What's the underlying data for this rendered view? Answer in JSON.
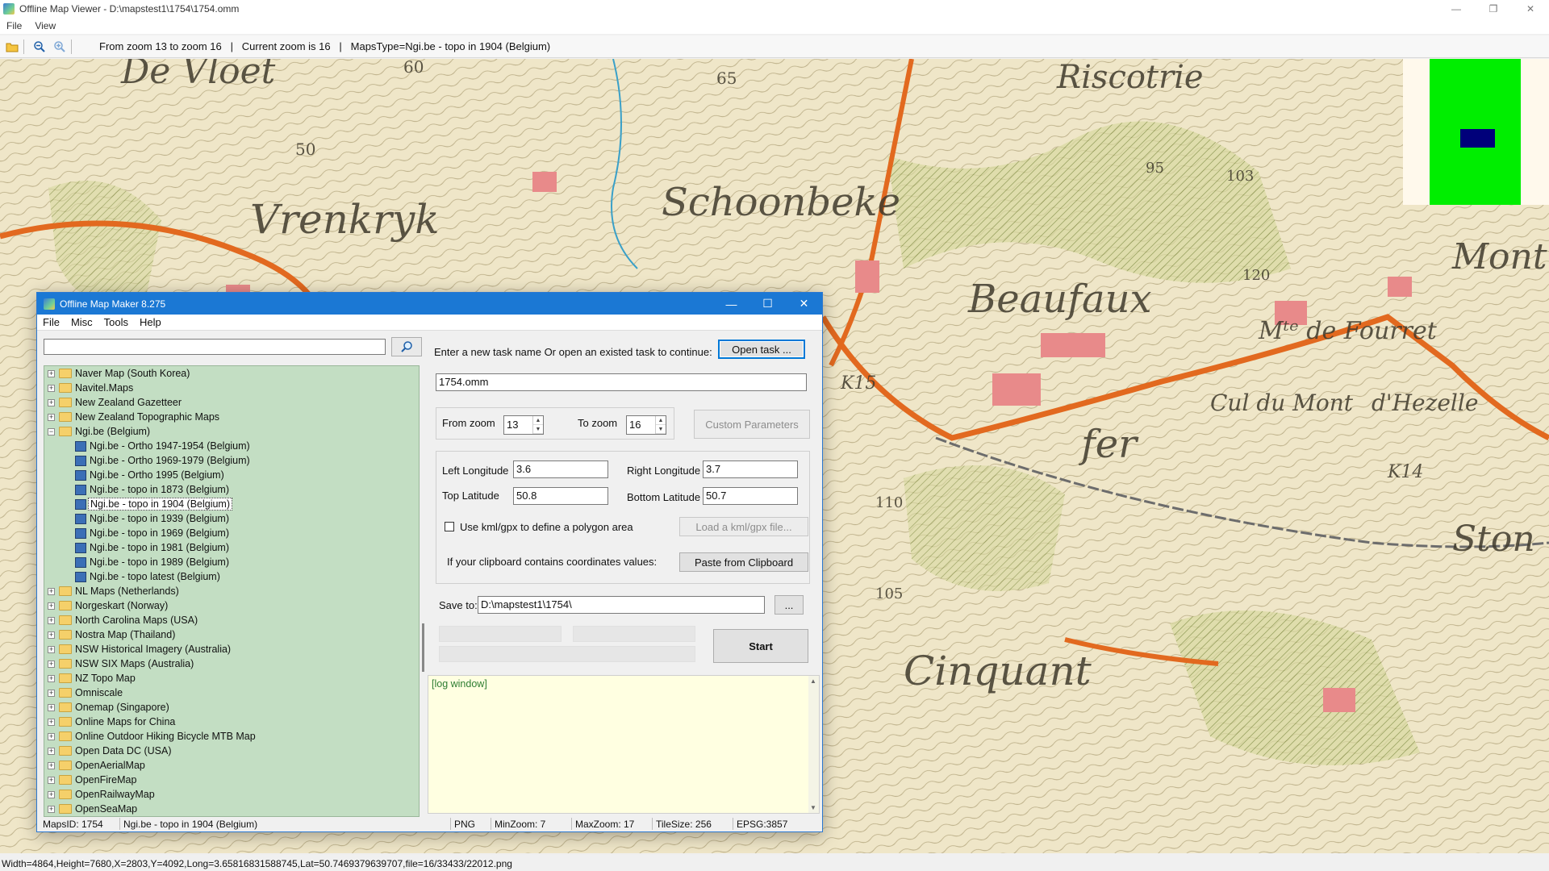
{
  "viewer": {
    "title": "Offline Map Viewer - D:\\mapstest1\\1754\\1754.omm",
    "menu": [
      "File",
      "View"
    ],
    "toolbar_status": "From zoom 13 to zoom 16   |   Current zoom is 16   |   MapsType=Ngi.be - topo in 1904 (Belgium)",
    "statusbar": "Width=4864,Height=7680,X=2803,Y=4092,Long=3.65816831588745,Lat=50.7469379639707,file=16/33433/22012.png",
    "window_buttons": {
      "minimize": "—",
      "restore": "❐",
      "close": "✕"
    }
  },
  "map": {
    "labels": [
      "De Vloet",
      "Riscotrie",
      "Vrenkryk",
      "Schoonbeke",
      "Beaufaux",
      "Mᵗᵉ de Fourret",
      "Cul du Mont",
      "d'Hezelle",
      "fer",
      "Mont",
      "Cinquant",
      "Ston"
    ],
    "numbers": [
      "60",
      "65",
      "50",
      "95",
      "103",
      "120",
      "K15",
      "110",
      "K14",
      "105"
    ],
    "colors": {
      "paper": "#efe6c8",
      "road": "#e2691f",
      "building": "#e88a8a",
      "contour": "#8a7a4a"
    }
  },
  "minimap": {
    "bg": "#fff9ec",
    "area": "#00ee00",
    "view": "#00007a"
  },
  "dialog": {
    "title": "Offline Map Maker 8.275",
    "menu": [
      "File",
      "Misc",
      "Tools",
      "Help"
    ],
    "search": {
      "value": "",
      "icon": "magnifier-icon"
    },
    "tree": [
      {
        "label": "Naver Map (South Korea)",
        "level": 0,
        "type": "folder",
        "expanded": false
      },
      {
        "label": "Navitel.Maps",
        "level": 0,
        "type": "folder",
        "expanded": false
      },
      {
        "label": "New Zealand Gazetteer",
        "level": 0,
        "type": "folder",
        "expanded": false
      },
      {
        "label": "New Zealand Topographic Maps",
        "level": 0,
        "type": "folder",
        "expanded": false
      },
      {
        "label": "Ngi.be (Belgium)",
        "level": 0,
        "type": "folder",
        "expanded": true
      },
      {
        "label": "Ngi.be - Ortho 1947-1954 (Belgium)",
        "level": 1,
        "type": "map"
      },
      {
        "label": "Ngi.be - Ortho 1969-1979 (Belgium)",
        "level": 1,
        "type": "map"
      },
      {
        "label": "Ngi.be - Ortho 1995 (Belgium)",
        "level": 1,
        "type": "map"
      },
      {
        "label": "Ngi.be - topo in 1873 (Belgium)",
        "level": 1,
        "type": "map"
      },
      {
        "label": "Ngi.be - topo in 1904 (Belgium)",
        "level": 1,
        "type": "map",
        "selected": true
      },
      {
        "label": "Ngi.be - topo in 1939 (Belgium)",
        "level": 1,
        "type": "map"
      },
      {
        "label": "Ngi.be - topo in 1969 (Belgium)",
        "level": 1,
        "type": "map"
      },
      {
        "label": "Ngi.be - topo in 1981 (Belgium)",
        "level": 1,
        "type": "map"
      },
      {
        "label": "Ngi.be - topo in 1989 (Belgium)",
        "level": 1,
        "type": "map"
      },
      {
        "label": "Ngi.be - topo latest (Belgium)",
        "level": 1,
        "type": "map"
      },
      {
        "label": "NL Maps (Netherlands)",
        "level": 0,
        "type": "folder",
        "expanded": false
      },
      {
        "label": "Norgeskart (Norway)",
        "level": 0,
        "type": "folder",
        "expanded": false
      },
      {
        "label": "North Carolina Maps (USA)",
        "level": 0,
        "type": "folder",
        "expanded": false
      },
      {
        "label": "Nostra Map (Thailand)",
        "level": 0,
        "type": "folder",
        "expanded": false
      },
      {
        "label": "NSW Historical Imagery (Australia)",
        "level": 0,
        "type": "folder",
        "expanded": false
      },
      {
        "label": "NSW SIX Maps (Australia)",
        "level": 0,
        "type": "folder",
        "expanded": false
      },
      {
        "label": "NZ Topo Map",
        "level": 0,
        "type": "folder",
        "expanded": false
      },
      {
        "label": "Omniscale",
        "level": 0,
        "type": "folder",
        "expanded": false
      },
      {
        "label": "Onemap (Singapore)",
        "level": 0,
        "type": "folder",
        "expanded": false
      },
      {
        "label": "Online Maps for China",
        "level": 0,
        "type": "folder",
        "expanded": false
      },
      {
        "label": "Online Outdoor Hiking Bicycle MTB Map",
        "level": 0,
        "type": "folder",
        "expanded": false
      },
      {
        "label": "Open Data DC (USA)",
        "level": 0,
        "type": "folder",
        "expanded": false
      },
      {
        "label": "OpenAerialMap",
        "level": 0,
        "type": "folder",
        "expanded": false
      },
      {
        "label": "OpenFireMap",
        "level": 0,
        "type": "folder",
        "expanded": false
      },
      {
        "label": "OpenRailwayMap",
        "level": 0,
        "type": "folder",
        "expanded": false
      },
      {
        "label": "OpenSeaMap",
        "level": 0,
        "type": "folder",
        "expanded": false
      }
    ],
    "task_prompt": "Enter a new task name Or open an existed task to continue:",
    "open_task_label": "Open task ...",
    "task_name": "1754.omm",
    "from_zoom_label": "From zoom",
    "from_zoom": "13",
    "to_zoom_label": "To zoom",
    "to_zoom": "16",
    "custom_params_label": "Custom Parameters",
    "left_longitude_label": "Left Longitude",
    "left_longitude": "3.6",
    "right_longitude_label": "Right Longitude",
    "right_longitude": "3.7",
    "top_latitude_label": "Top Latitude",
    "top_latitude": "50.8",
    "bottom_latitude_label": "Bottom Latitude",
    "bottom_latitude": "50.7",
    "kml_checkbox_label": "Use kml/gpx to define a polygon area",
    "kml_checked": false,
    "load_kml_label": "Load a kml/gpx file...",
    "clipboard_prompt": "If your clipboard contains coordinates values:",
    "paste_label": "Paste from Clipboard",
    "save_to_label": "Save to:",
    "save_to": "D:\\mapstest1\\1754\\",
    "browse_label": "...",
    "start_label": "Start",
    "log_text": "[log window]",
    "status": {
      "maps_id": "MapsID: 1754",
      "maps_name": "Ngi.be - topo in 1904 (Belgium)",
      "format": "PNG",
      "min_zoom": "MinZoom: 7",
      "max_zoom": "MaxZoom: 17",
      "tile_size": "TileSize: 256",
      "epsg": "EPSG:3857"
    }
  }
}
